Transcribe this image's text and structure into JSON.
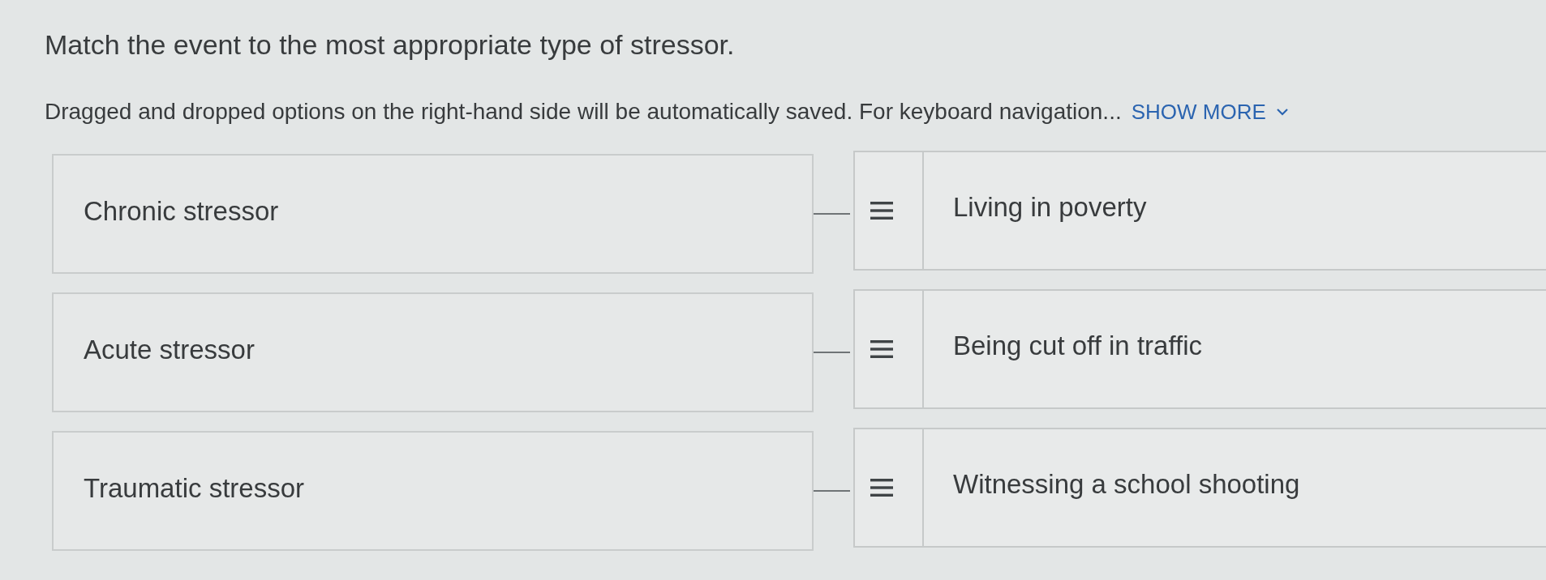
{
  "prompt": "Match the event to the most appropriate type of stressor.",
  "instructions": {
    "text": "Dragged and dropped options on the right-hand side will be automatically saved. For keyboard navigation...",
    "toggle": "SHOW MORE",
    "expanded": false
  },
  "pairs": [
    {
      "target": "Chronic stressor",
      "option": "Living in poverty"
    },
    {
      "target": "Acute stressor",
      "option": "Being cut off in traffic"
    },
    {
      "target": "Traumatic stressor",
      "option": "Witnessing a school shooting"
    }
  ]
}
